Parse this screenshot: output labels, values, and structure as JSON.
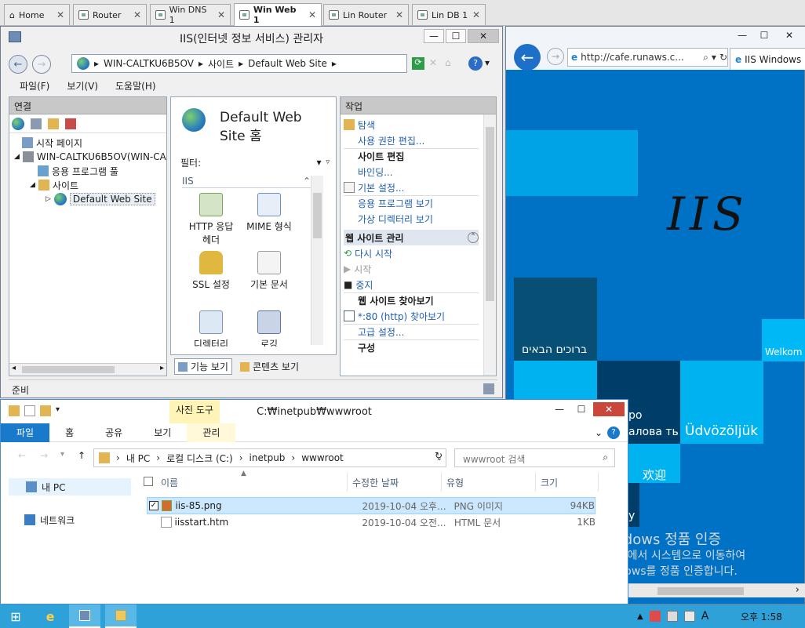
{
  "vm_tabs": [
    {
      "label": "Home",
      "active": false
    },
    {
      "label": "Router",
      "active": false
    },
    {
      "label": "Win DNS 1",
      "active": false
    },
    {
      "label": "Win Web 1",
      "active": true
    },
    {
      "label": "Lin Router",
      "active": false
    },
    {
      "label": "Lin DB 1",
      "active": false
    }
  ],
  "iis": {
    "title": "IIS(인터넷 정보 서비스) 관리자",
    "breadcrumb": [
      "WIN-CALTKU6B5OV",
      "사이트",
      "Default Web Site"
    ],
    "menu": [
      "파일(F)",
      "보기(V)",
      "도움말(H)"
    ],
    "connections": {
      "header": "연결",
      "tree": [
        "시작 페이지",
        "WIN-CALTKU6B5OV(WIN-CA",
        "응용 프로그램 풀",
        "사이트",
        "Default Web Site"
      ]
    },
    "center": {
      "title": "Default Web Site 홈",
      "filter_label": "필터:",
      "group": "IIS",
      "features": [
        "HTTP 응답 헤더",
        "MIME 형식",
        "SSL 설정",
        "기본 문서",
        "디렉터리",
        "로깅"
      ],
      "view_tabs": [
        "기능 보기",
        "콘텐츠 보기"
      ]
    },
    "actions": {
      "header": "작업",
      "explore": "탐색",
      "edit_perms": "사용 권한 편집...",
      "edit_site_header": "사이트 편집",
      "bindings": "바인딩...",
      "basic_settings": "기본 설정...",
      "view_apps": "응용 프로그램 보기",
      "view_vdirs": "가상 디렉터리 보기",
      "manage_header": "웹 사이트 관리",
      "restart": "다시 시작",
      "start": "시작",
      "stop": "중지",
      "browse_header": "웹 사이트 찾아보기",
      "browse_80": "*:80 (http) 찾아보기",
      "advanced": "고급 설정...",
      "configure": "구성"
    },
    "status": "준비"
  },
  "ie": {
    "url": "http://cafe.runaws.c...",
    "tab_label": "IIS Windows",
    "hand_text": "IIS",
    "welcomes": [
      "ברוכים הבאים",
      "Welkom",
      "Üdvözöljük",
      "欢迎",
      "ро",
      "алова ть",
      "у"
    ]
  },
  "activation": {
    "line1": "Windows 정품 인증",
    "line2": "제어판에서 시스템으로 이동하여",
    "line3": "Windows를 정품 인증합니다."
  },
  "explorer": {
    "title": "C:₩inetpub₩wwwroot",
    "context_tab": "사진 도구",
    "context_sub": "관리",
    "ribbon_tabs": [
      "파일",
      "홈",
      "공유",
      "보기"
    ],
    "path": [
      "내 PC",
      "로컬 디스크 (C:)",
      "inetpub",
      "wwwroot"
    ],
    "search_placeholder": "wwwroot 검색",
    "nav": [
      "내 PC",
      "네트워크"
    ],
    "columns": [
      "이름",
      "수정한 날짜",
      "유형",
      "크기"
    ],
    "files": [
      {
        "name": "iis-85.png",
        "date": "2019-10-04 오후...",
        "type": "PNG 이미지",
        "size": "94KB",
        "selected": true
      },
      {
        "name": "iisstart.htm",
        "date": "2019-10-04 오전...",
        "type": "HTML 문서",
        "size": "1KB",
        "selected": false
      }
    ]
  },
  "taskbar": {
    "time": "오후 1:58",
    "ime": "A"
  }
}
